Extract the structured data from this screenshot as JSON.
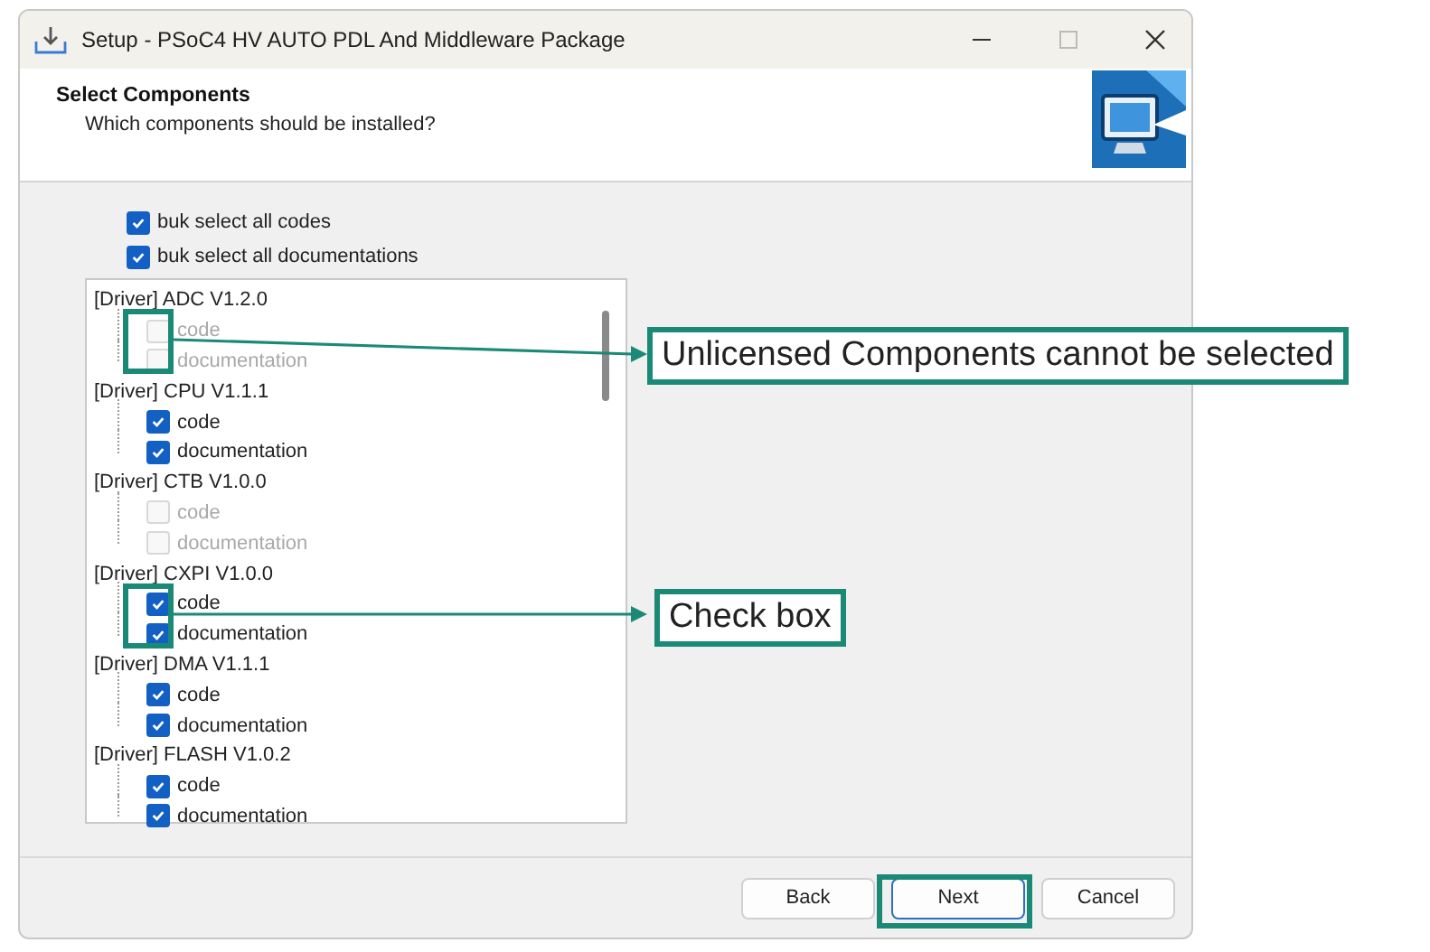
{
  "window": {
    "title": "Setup - PSoC4 HV AUTO PDL And Middleware Package"
  },
  "header": {
    "title": "Select Components",
    "subtitle": "Which components should be installed?"
  },
  "bulk_options": [
    {
      "label": "buk select all codes",
      "checked": true
    },
    {
      "label": "buk select all documentations",
      "checked": true
    }
  ],
  "components": [
    {
      "label": "[Driver] ADC V1.2.0",
      "children": [
        {
          "label": "code",
          "checked": false,
          "disabled": true
        },
        {
          "label": "documentation",
          "checked": false,
          "disabled": true
        }
      ]
    },
    {
      "label": "[Driver] CPU V1.1.1",
      "children": [
        {
          "label": "code",
          "checked": true,
          "disabled": false
        },
        {
          "label": "documentation",
          "checked": true,
          "disabled": false
        }
      ]
    },
    {
      "label": "[Driver] CTB V1.0.0",
      "children": [
        {
          "label": "code",
          "checked": false,
          "disabled": true
        },
        {
          "label": "documentation",
          "checked": false,
          "disabled": true
        }
      ]
    },
    {
      "label": "[Driver] CXPI V1.0.0",
      "children": [
        {
          "label": "code",
          "checked": true,
          "disabled": false
        },
        {
          "label": "documentation",
          "checked": true,
          "disabled": false
        }
      ]
    },
    {
      "label": "[Driver] DMA V1.1.1",
      "children": [
        {
          "label": "code",
          "checked": true,
          "disabled": false
        },
        {
          "label": "documentation",
          "checked": true,
          "disabled": false
        }
      ]
    },
    {
      "label": "[Driver] FLASH V1.0.2",
      "children": [
        {
          "label": "code",
          "checked": true,
          "disabled": false
        },
        {
          "label": "documentation",
          "checked": true,
          "disabled": false
        }
      ]
    }
  ],
  "buttons": [
    {
      "label": "Back",
      "highlighted": false
    },
    {
      "label": "Next",
      "highlighted": true
    },
    {
      "label": "Cancel",
      "highlighted": false
    }
  ],
  "annotations": [
    {
      "text": "Unlicensed Components cannot be selected"
    },
    {
      "text": "Check box"
    }
  ]
}
